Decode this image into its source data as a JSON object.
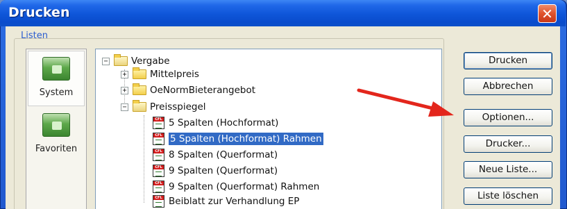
{
  "window": {
    "title": "Drucken",
    "close_icon": "close-icon"
  },
  "group": {
    "label": "Listen"
  },
  "shortcuts": [
    {
      "label": "System",
      "icon": "system-folder-icon",
      "selected": true
    },
    {
      "label": "Favoriten",
      "icon": "favorites-folder-icon",
      "selected": false
    }
  ],
  "tree": {
    "root": {
      "label": "Vergabe",
      "expander": "⊟"
    },
    "children": [
      {
        "label": "Mittelpreis",
        "expander": "+"
      },
      {
        "label": "OeNormBieterangebot",
        "expander": "+"
      },
      {
        "label": "Preisspiegel",
        "expander": "−"
      }
    ],
    "items": [
      {
        "label": "5 Spalten (Hochformat)"
      },
      {
        "label": "5 Spalten (Hochformat) Rahmen",
        "selected": true
      },
      {
        "label": "8 Spalten (Querformat)"
      },
      {
        "label": "9 Spalten (Querformat)"
      },
      {
        "label": "9 Spalten (Querformat) Rahmen"
      },
      {
        "label": "Beiblatt zur Verhandlung  EP"
      }
    ]
  },
  "buttons": {
    "print": "Drucken",
    "cancel": "Abbrechen",
    "options": "Optionen...",
    "printer": "Drucker...",
    "new_list": "Neue Liste...",
    "delete_list": "Liste löschen"
  },
  "colors": {
    "title_bar": "#0a4ccc",
    "selection": "#316ac5",
    "arrow": "#e3261c",
    "dialog_bg": "#ece9d8"
  }
}
